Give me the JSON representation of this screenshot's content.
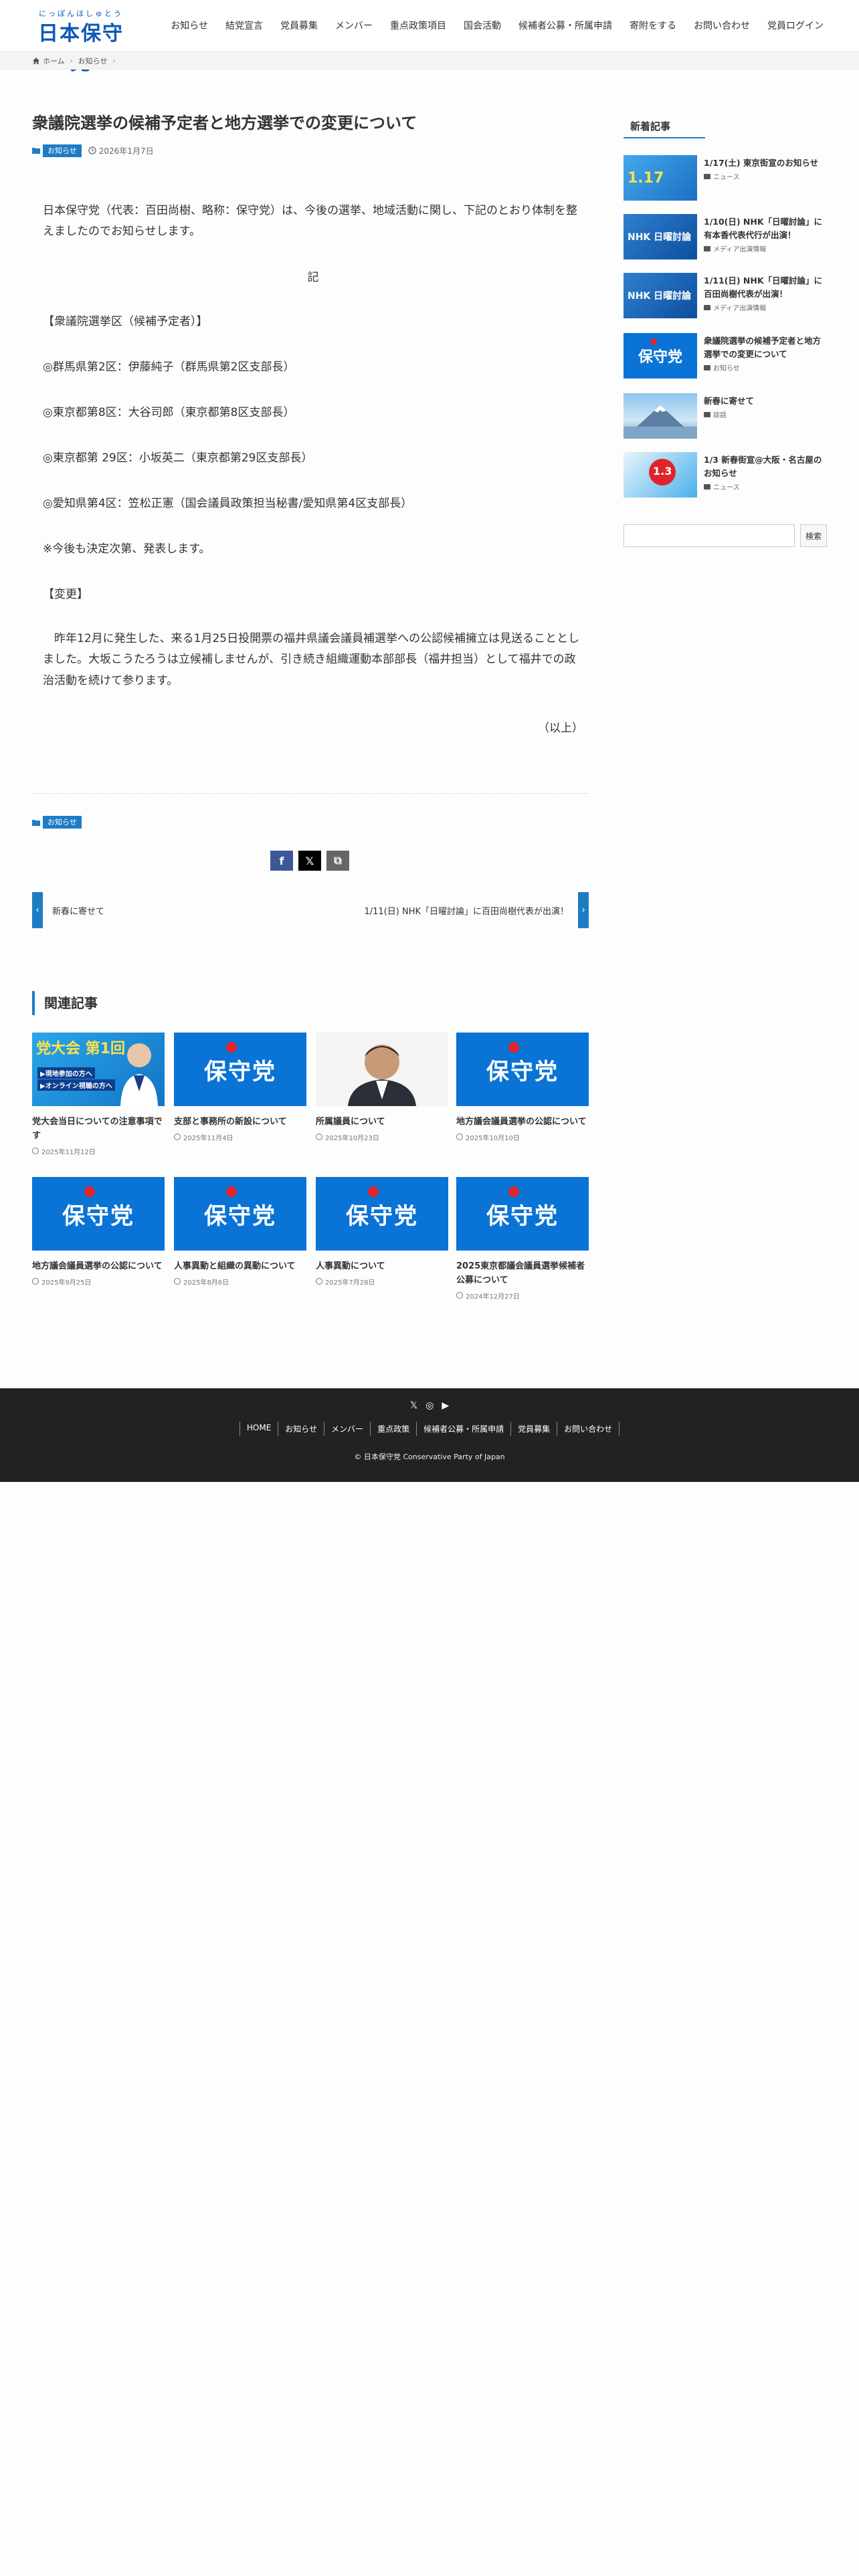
{
  "header": {
    "logo_ruby": "にっぽんほしゅとう",
    "logo_text": "日本保守党",
    "nav": [
      "お知らせ",
      "結党宣言",
      "党員募集",
      "メンバー",
      "重点政策項目",
      "国会活動",
      "候補者公募・所属申請",
      "寄附をする",
      "お問い合わせ",
      "党員ログイン"
    ]
  },
  "breadcrumb": {
    "home": "ホーム",
    "current": "お知らせ"
  },
  "article": {
    "title": "衆議院選挙の候補予定者と地方選挙での変更について",
    "category": "お知らせ",
    "date": "2026年1月7日",
    "paragraphs": [
      "日本保守党（代表：百田尚樹、略称：保守党）は、今後の選挙、地域活動に関し、下記のとおり体制を整えましたのでお知らせします。",
      "記",
      "【衆議院選挙区（候補予定者）】",
      "◎群馬県第2区：伊藤純子（群馬県第2区支部長）",
      "◎東京都第8区：大谷司郎（東京都第8区支部長）",
      "◎東京都第 29区：小坂英二（東京都第29区支部長）",
      "◎愛知県第4区：笠松正憲（国会議員政策担当秘書/愛知県第4区支部長）",
      "※今後も決定次第、発表します。",
      "【変更】",
      "　昨年12月に発生した、来る1月25日投開票の福井県議会議員補選挙への公認候補擁立は見送ることとしました。大坂こうたろうは立候補しませんが、引き続き組織運動本部部長（福井担当）として福井での政治活動を続けて参ります。",
      "（以上）"
    ],
    "footer_category": "お知らせ"
  },
  "share": {
    "facebook": "f",
    "x": "𝕏",
    "copy": "⧉"
  },
  "post_nav": {
    "prev": "新春に寄せて",
    "next": "1/11(日) NHK「日曜討論」に百田尚樹代表が出演！"
  },
  "related": {
    "heading": "関連記事",
    "items": [
      {
        "title": "党大会当日についての注意事項です",
        "date": "2025年11月12日",
        "thumb": "taikai",
        "thumb_title": "党大会 第1回",
        "thumb_sub1": "▶現地参加の方へ",
        "thumb_sub2": "▶オンライン視聴の方へ"
      },
      {
        "title": "支部と事務所の新設について",
        "date": "2025年11月4日",
        "thumb": "party",
        "thumb_text": "保守党"
      },
      {
        "title": "所属議員について",
        "date": "2025年10月23日",
        "thumb": "person"
      },
      {
        "title": "地方議会議員選挙の公認について",
        "date": "2025年10月10日",
        "thumb": "party",
        "thumb_text": "保守党"
      },
      {
        "title": "地方議会議員選挙の公認について",
        "date": "2025年9月25日",
        "thumb": "party",
        "thumb_text": "保守党"
      },
      {
        "title": "人事異動と組織の異動について",
        "date": "2025年8月6日",
        "thumb": "party",
        "thumb_text": "保守党"
      },
      {
        "title": "人事異動について",
        "date": "2025年7月28日",
        "thumb": "party",
        "thumb_text": "保守党"
      },
      {
        "title": "2025東京都議会議員選挙候補者公募について",
        "date": "2024年12月27日",
        "thumb": "party",
        "thumb_text": "保守党"
      }
    ]
  },
  "sidebar": {
    "heading": "新着記事",
    "items": [
      {
        "title": "1/17(土) 東京街宣のお知らせ",
        "category": "ニュース",
        "thumb": "blue",
        "thumb_text": "1.17"
      },
      {
        "title": "1/10(日) NHK「日曜討論」に有本香代表代行が出演！",
        "category": "メディア出演情報",
        "thumb": "navy",
        "thumb_text": "NHK 日曜討論"
      },
      {
        "title": "1/11(日) NHK「日曜討論」に百田尚樹代表が出演！",
        "category": "メディア出演情報",
        "thumb": "navy",
        "thumb_text": "NHK 日曜討論"
      },
      {
        "title": "衆議院選挙の候補予定者と地方選挙での変更について",
        "category": "お知らせ",
        "thumb": "party",
        "thumb_text": "保守党"
      },
      {
        "title": "新春に寄せて",
        "category": "談話",
        "thumb": "mt",
        "thumb_text": ""
      },
      {
        "title": "1/3 新春街宣@大阪・名古屋のお知らせ",
        "category": "ニュース",
        "thumb": "sp",
        "thumb_text": "1.3"
      }
    ],
    "search_placeholder": "",
    "search_button": "検索"
  },
  "footer": {
    "social": [
      "𝕏",
      "◎",
      "▶"
    ],
    "nav": [
      "HOME",
      "お知らせ",
      "メンバー",
      "重点政策",
      "候補者公募・所属申請",
      "党員募集",
      "お問い合わせ"
    ],
    "copyright": "© 日本保守党 Conservative Party of Japan"
  },
  "colors": {
    "accent": "#1e7cc4",
    "brand": "#0a59b8",
    "footer_bg": "#222222"
  }
}
